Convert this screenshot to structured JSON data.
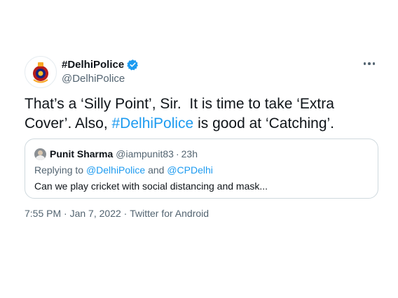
{
  "author": {
    "display_name": "#DelhiPolice",
    "handle": "@DelhiPolice"
  },
  "tweet": {
    "text_part1": "That’s a ‘Silly Point’, Sir.  It is time to take ‘Extra Cover’. Also, ",
    "hashtag": "#DelhiPolice",
    "text_part2": " is good at ‘Catching’."
  },
  "quoted_tweet": {
    "name": "Punit Sharma",
    "handle": "@iampunit83",
    "separator": "·",
    "time": "23h",
    "replying_prefix": "Replying to ",
    "mention1": "@DelhiPolice",
    "and_word": " and ",
    "mention2": "@CPDelhi",
    "text": "Can we play cricket with social distancing and mask..."
  },
  "meta": {
    "time": "7:55 PM",
    "sep1": " · ",
    "date": "Jan 7, 2022",
    "sep2": " · ",
    "source": "Twitter for Android"
  },
  "colors": {
    "link": "#1d9bf0",
    "secondary": "#536471",
    "text": "#0f1419",
    "border": "#cfd9de"
  },
  "icons": {
    "verified": "verified-badge-icon",
    "more": "more-options-icon",
    "avatar": "delhi-police-emblem-avatar"
  }
}
